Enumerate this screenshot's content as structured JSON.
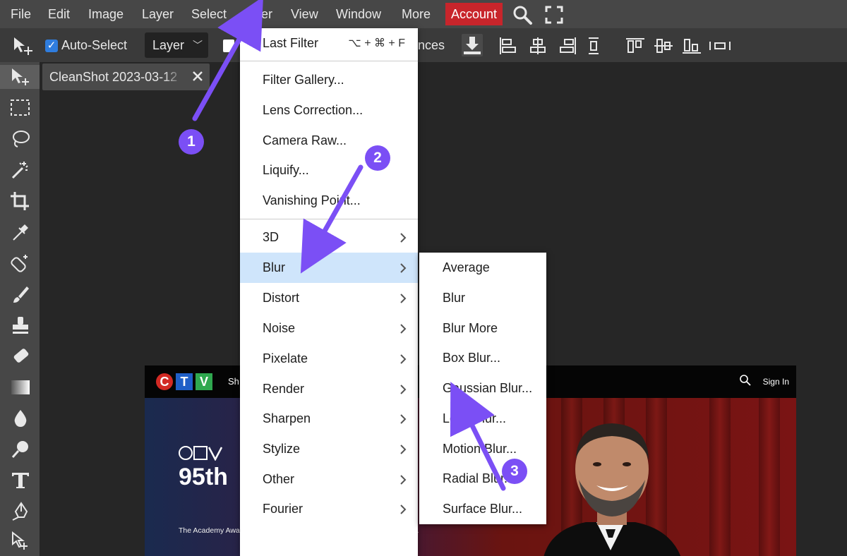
{
  "menubar": {
    "items": [
      "File",
      "Edit",
      "Image",
      "Layer",
      "Select",
      "Filter",
      "View",
      "Window",
      "More"
    ],
    "account": "Account",
    "search_icon": "search-icon",
    "fullscreen_icon": "fullscreen-icon"
  },
  "options": {
    "auto_select": "Auto-Select",
    "layer_select": "Layer",
    "partial_text": "nces"
  },
  "tab": {
    "title": "CleanShot 2023-03-12"
  },
  "filter_menu": {
    "last_filter": "Last Filter",
    "last_filter_shortcut": "⌥ + ⌘ + F",
    "group1": [
      "Filter Gallery...",
      "Lens Correction...",
      "Camera Raw...",
      "Liquify...",
      "Vanishing Point..."
    ],
    "submenus": [
      "3D",
      "Blur",
      "Distort",
      "Noise",
      "Pixelate",
      "Render",
      "Sharpen",
      "Stylize",
      "Other",
      "Fourier"
    ],
    "highlighted": "Blur"
  },
  "blur_menu": {
    "items": [
      "Average",
      "Blur",
      "Blur More",
      "Box Blur...",
      "Gaussian Blur...",
      "Lens Blur...",
      "Motion Blur...",
      "Radial Blur...",
      "Surface Blur..."
    ]
  },
  "canvas": {
    "ctv_letters": [
      "C",
      "T",
      "V"
    ],
    "nav_text": "Sh",
    "sign_in": "Sign In",
    "hero_title": "95th",
    "hero_desc": "The Academy Awards will be honouring achievements in the film industry."
  },
  "annotations": {
    "badges": [
      "1",
      "2",
      "3"
    ],
    "color": "#7b4ff5"
  },
  "colors": {
    "menubar_bg": "#474747",
    "account_bg": "#c8252b",
    "highlight_bg": "#cfe5fb",
    "checkbox": "#2f7dde"
  }
}
